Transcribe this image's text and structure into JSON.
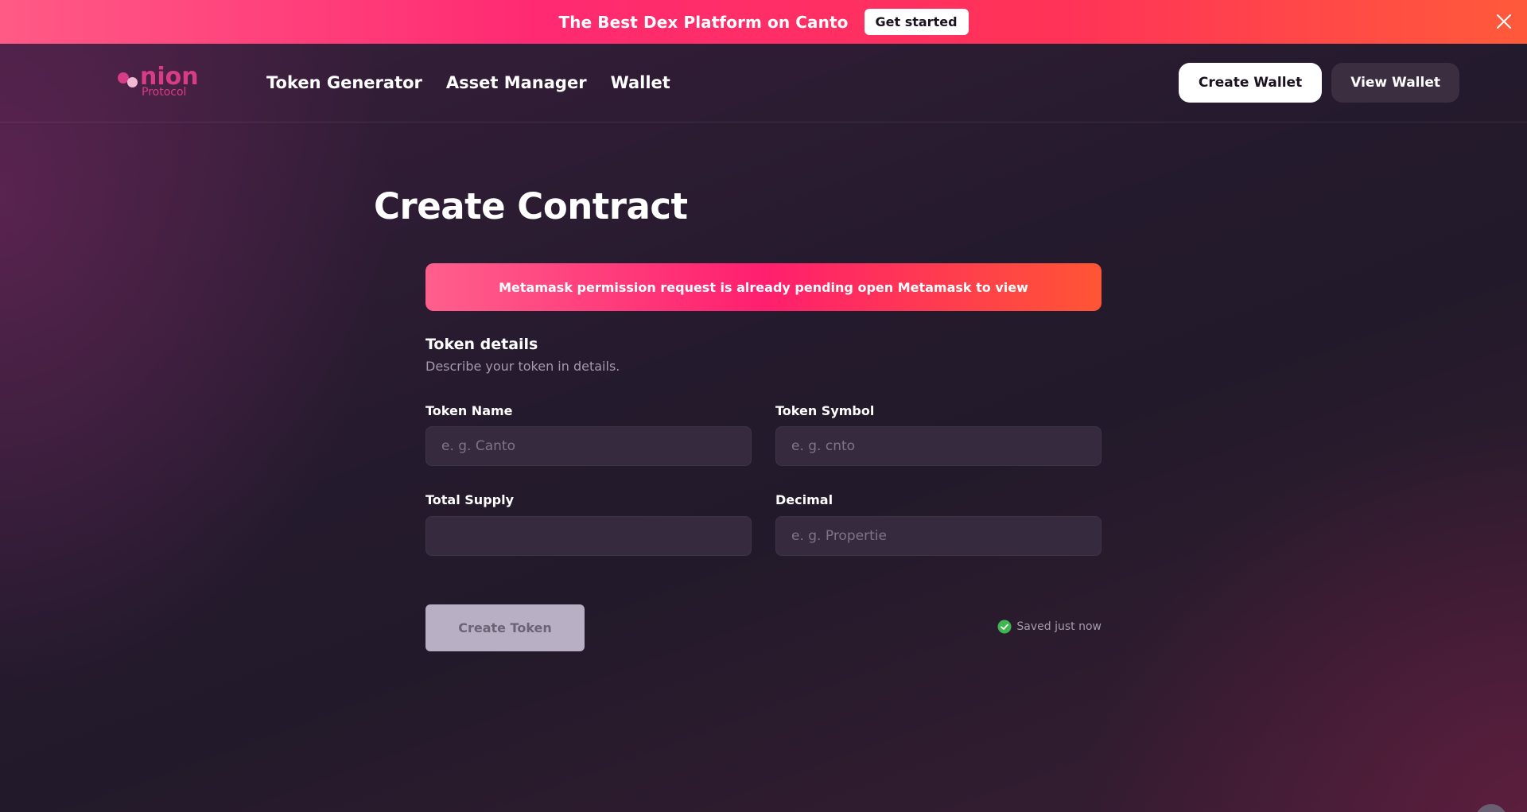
{
  "banner": {
    "text": "The Best Dex Platform on Canto",
    "cta_label": "Get started"
  },
  "brand": {
    "logo_word": "nion",
    "logo_sub": "Protocol",
    "color": "#d83c86"
  },
  "nav": {
    "links": [
      "Token Generator",
      "Asset Manager",
      "Wallet"
    ],
    "create_wallet_label": "Create Wallet",
    "view_wallet_label": "View Wallet"
  },
  "main": {
    "title": "Create Contract",
    "alert": "Metamask permission request is already pending open Metamask to view",
    "section_title": "Token details",
    "section_subtitle": "Describe your token in details.",
    "fields": {
      "token_name": {
        "label": "Token Name",
        "value": "",
        "placeholder": "e. g. Canto"
      },
      "token_symbol": {
        "label": "Token Symbol",
        "value": "",
        "placeholder": "e. g. cnto"
      },
      "total_supply": {
        "label": "Total Supply",
        "value": "",
        "placeholder": ""
      },
      "decimal": {
        "label": "Decimal",
        "value": "",
        "placeholder": "e. g. Propertie"
      }
    },
    "submit_label": "Create Token",
    "saved_status": "Saved just now"
  },
  "colors": {
    "accent_pink": "#ff2a72",
    "accent_orange": "#ff5534",
    "success_green": "#3fb650"
  },
  "icons": {
    "close": "close-icon",
    "check": "check-circle-icon"
  }
}
